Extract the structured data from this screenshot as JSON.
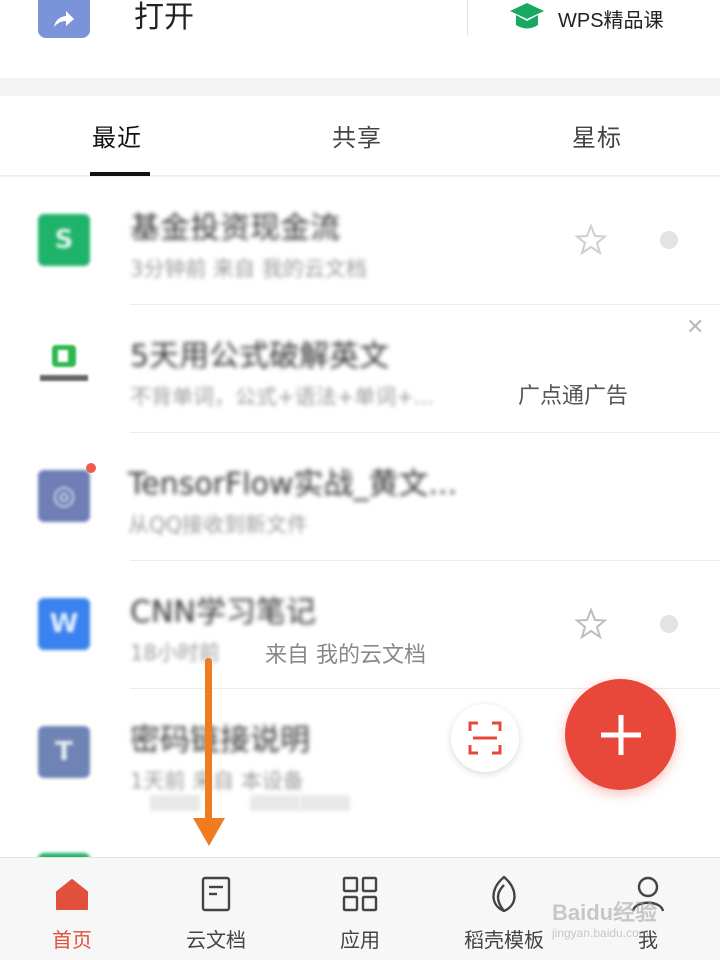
{
  "topbar": {
    "open_label": "打开",
    "course_label": "WPS精品课"
  },
  "tabs": [
    {
      "label": "最近",
      "active": true
    },
    {
      "label": "共享",
      "active": false
    },
    {
      "label": "星标",
      "active": false
    }
  ],
  "files": [
    {
      "title": "基金投资现金流",
      "subtitle": "3分钟前    来自 我的云文档",
      "icon": "spreadsheet-icon",
      "color": "#1fb36a",
      "starred": false
    },
    {
      "title": "5天用公式破解英文",
      "subtitle": "不背单词，公式+语法+单词+...",
      "icon": "ad-logo-icon",
      "color": "#2db84d",
      "ad_label": "广点通广告",
      "is_ad": true
    },
    {
      "title": "TensorFlow实战_黄文...",
      "subtitle": "从QQ接收到新文件",
      "icon": "pdf-icon",
      "color": "#6f7fb5",
      "unread": true
    },
    {
      "title": "CNN学习笔记",
      "subtitle": "18小时前",
      "subtitle_clear": "来自 我的云文档",
      "icon": "word-icon",
      "color": "#3b82f0",
      "starred": false
    },
    {
      "title": "密码链接说明",
      "subtitle": "1天前    来自 本设备",
      "icon": "text-icon",
      "color": "#6f84b5"
    }
  ],
  "bottom_nav": [
    {
      "label": "首页",
      "icon": "home-icon",
      "active": true
    },
    {
      "label": "云文档",
      "icon": "cloud-doc-icon",
      "active": false
    },
    {
      "label": "应用",
      "icon": "apps-grid-icon",
      "active": false
    },
    {
      "label": "稻壳模板",
      "icon": "leaf-icon",
      "active": false
    },
    {
      "label": "我",
      "icon": "user-icon",
      "active": false
    }
  ],
  "watermark": {
    "brand": "Baidu经验",
    "url": "jingyan.baidu.com"
  },
  "colors": {
    "accent": "#e8483a",
    "arrow": "#f07c22",
    "active_nav": "#e14f3d"
  }
}
